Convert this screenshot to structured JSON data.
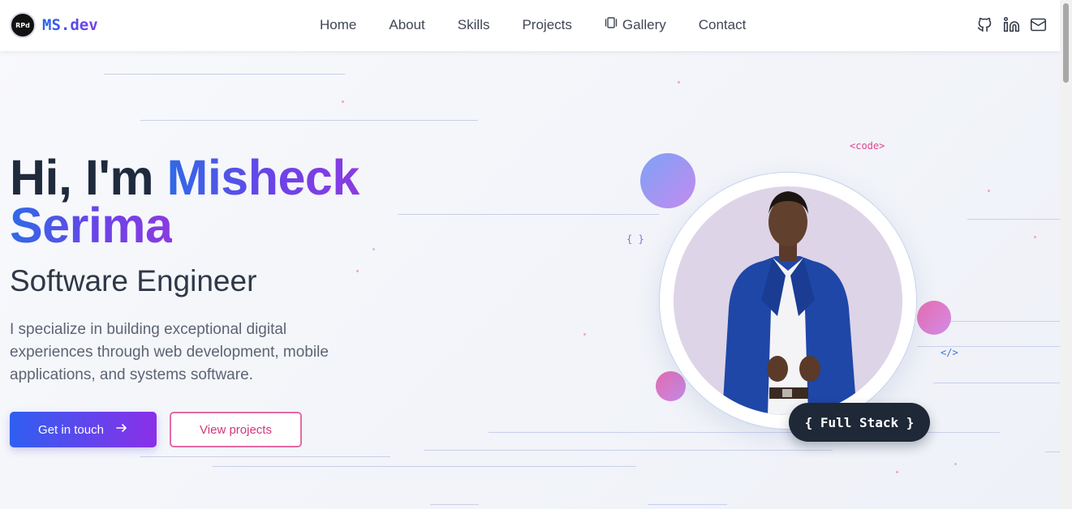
{
  "brand": {
    "logo_text": "RPd",
    "name": "MS.dev"
  },
  "nav": {
    "items": [
      {
        "label": "Home"
      },
      {
        "label": "About"
      },
      {
        "label": "Skills"
      },
      {
        "label": "Projects"
      },
      {
        "label": "Gallery",
        "icon": "gallery-icon"
      },
      {
        "label": "Contact"
      }
    ],
    "social_icons": [
      "github-icon",
      "linkedin-icon",
      "mail-icon"
    ]
  },
  "hero": {
    "greeting": "Hi, I'm",
    "first_name": "Misheck",
    "last_name": "Serima",
    "role": "Software Engineer",
    "description": "I specialize in building exceptional digital experiences through web development, mobile applications, and systems software.",
    "primary_button": "Get in touch",
    "secondary_button": "View projects"
  },
  "decor": {
    "code_tag": "<code>",
    "braces_tag": "{ }",
    "slash_tag": "</>",
    "badge": "{ Full Stack }"
  },
  "colors": {
    "accent_blue": "#2f5ff0",
    "accent_purple": "#8b2fe8",
    "accent_pink": "#e66aa6",
    "badge_dark": "#1e2836"
  }
}
